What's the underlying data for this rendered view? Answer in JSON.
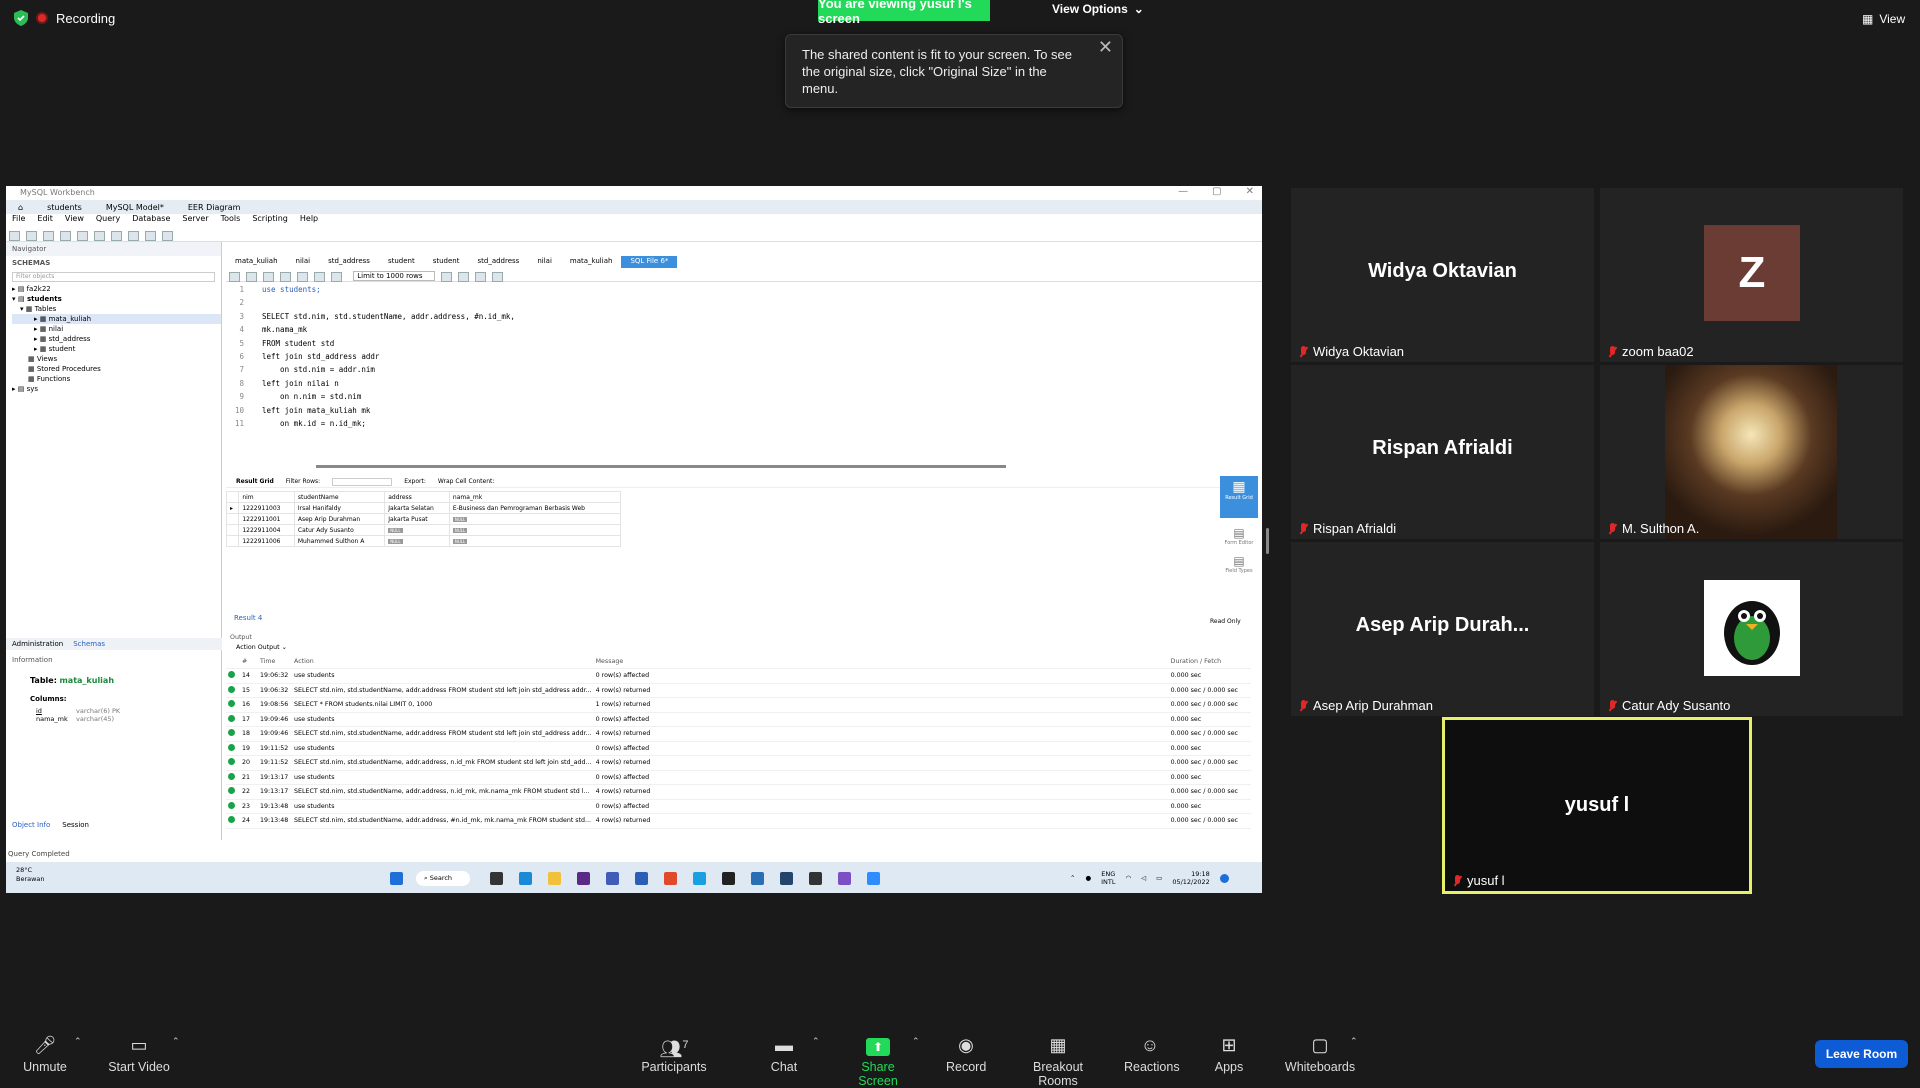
{
  "topbar": {
    "recording": "Recording",
    "viewing": "You are viewing yusuf l's screen",
    "view_options": "View Options",
    "view": "View"
  },
  "tooltip": {
    "text": "The shared content is fit to your screen. To see the original size, click \"Original Size\" in the menu."
  },
  "workbench": {
    "title": "MySQL Workbench",
    "tabs": [
      "students",
      "MySQL Model*",
      "EER Diagram"
    ],
    "menu": [
      "File",
      "Edit",
      "View",
      "Query",
      "Database",
      "Server",
      "Tools",
      "Scripting",
      "Help"
    ],
    "navigator": "Navigator",
    "schemas": "SCHEMAS",
    "filter": "Filter objects",
    "tree": [
      "fa2k22",
      "students",
      "Tables",
      "mata_kuliah",
      "nilai",
      "std_address",
      "student",
      "Views",
      "Stored Procedures",
      "Functions",
      "sys"
    ],
    "sql_tabs": [
      "mata_kuliah",
      "nilai",
      "std_address",
      "student",
      "student",
      "std_address",
      "nilai",
      "mata_kuliah",
      "SQL File 6*"
    ],
    "limit": "Limit to 1000 rows",
    "code": [
      "use students;",
      "",
      "SELECT std.nim, std.studentName, addr.address, #n.id_mk,",
      "mk.nama_mk",
      "FROM student std",
      "left join std_address addr",
      "    on std.nim = addr.nim",
      "left join nilai n",
      "    on n.nim = std.nim",
      "left join mata_kuliah mk",
      "    on mk.id = n.id_mk;"
    ],
    "result_bar": {
      "grid": "Result Grid",
      "filter": "Filter Rows:",
      "export": "Export:",
      "wrap": "Wrap Cell Content:"
    },
    "result_headers": [
      "nim",
      "studentName",
      "address",
      "nama_mk"
    ],
    "result_rows": [
      [
        "1222911003",
        "Irsal Hanifaldy",
        "Jakarta Selatan",
        "E-Business dan Pemrograman Berbasis Web"
      ],
      [
        "1222911001",
        "Asep Arip Durahman",
        "Jakarta Pusat",
        "NULL"
      ],
      [
        "1222911004",
        "Catur Ady Susanto",
        "NULL",
        "NULL"
      ],
      [
        "1222911006",
        "Muhammed Sulthon A",
        "NULL",
        "NULL"
      ]
    ],
    "side_buttons": [
      "Result Grid",
      "Form Editor",
      "Field Types"
    ],
    "read_only": "Read Only",
    "result_tab": "Result 4",
    "output_label": "Output",
    "action_output": "Action Output",
    "output_headers": [
      "#",
      "Time",
      "Action",
      "Message",
      "Duration / Fetch"
    ],
    "output_rows": [
      [
        "14",
        "19:06:32",
        "use students",
        "0 row(s) affected",
        "0.000 sec"
      ],
      [
        "15",
        "19:06:32",
        "SELECT std.nim, std.studentName, addr.address  FROM student std left join std_address addr...",
        "4 row(s) returned",
        "0.000 sec / 0.000 sec"
      ],
      [
        "16",
        "19:08:56",
        "SELECT * FROM students.nilai LIMIT 0, 1000",
        "1 row(s) returned",
        "0.000 sec / 0.000 sec"
      ],
      [
        "17",
        "19:09:46",
        "use students",
        "0 row(s) affected",
        "0.000 sec"
      ],
      [
        "18",
        "19:09:46",
        "SELECT std.nim, std.studentName, addr.address  FROM student std left join std_address addr...",
        "4 row(s) returned",
        "0.000 sec / 0.000 sec"
      ],
      [
        "19",
        "19:11:52",
        "use students",
        "0 row(s) affected",
        "0.000 sec"
      ],
      [
        "20",
        "19:11:52",
        "SELECT std.nim, std.studentName, addr.address, n.id_mk  FROM student std left join std_add...",
        "4 row(s) returned",
        "0.000 sec / 0.000 sec"
      ],
      [
        "21",
        "19:13:17",
        "use students",
        "0 row(s) affected",
        "0.000 sec"
      ],
      [
        "22",
        "19:13:17",
        "SELECT std.nim, std.studentName, addr.address, n.id_mk, mk.nama_mk  FROM student std l...",
        "4 row(s) returned",
        "0.000 sec / 0.000 sec"
      ],
      [
        "23",
        "19:13:48",
        "use students",
        "0 row(s) affected",
        "0.000 sec"
      ],
      [
        "24",
        "19:13:48",
        "SELECT std.nim, std.studentName, addr.address, #n.id_mk,  mk.nama_mk  FROM student std...",
        "4 row(s) returned",
        "0.000 sec / 0.000 sec"
      ]
    ],
    "info_tabs": [
      "Administration",
      "Schemas"
    ],
    "information": "Information",
    "table_label": "Table:",
    "table_name": "mata_kuliah",
    "columns_label": "Columns:",
    "columns": [
      [
        "id",
        "varchar(6) PK"
      ],
      [
        "nama_mk",
        "varchar(45)"
      ]
    ],
    "bottom_tabs": [
      "Object Info",
      "Session"
    ],
    "status": "Query Completed",
    "taskbar": {
      "temp": "28°C",
      "weather": "Berawan",
      "search": "Search",
      "lang1": "ENG",
      "lang2": "INTL",
      "time": "19:18",
      "date": "05/12/2022"
    }
  },
  "participants": [
    {
      "tile": "Widya Oktavian",
      "label": "Widya Oktavian"
    },
    {
      "tile": "Z",
      "label": "zoom baa02",
      "avatar_color": "#6b3c33"
    },
    {
      "tile": "Rispan Afrialdi",
      "label": "Rispan Afrialdi"
    },
    {
      "tile": "",
      "label": "M. Sulthon A."
    },
    {
      "tile": "Asep Arip Durah...",
      "label": "Asep Arip Durahman"
    },
    {
      "tile": "",
      "label": "Catur Ady Susanto"
    },
    {
      "tile": "yusuf l",
      "label": "yusuf l"
    }
  ],
  "bottombar": {
    "unmute": "Unmute",
    "start_video": "Start Video",
    "participants": "Participants",
    "participants_count": "7",
    "chat": "Chat",
    "share_screen": "Share Screen",
    "record": "Record",
    "breakout": "Breakout Rooms",
    "reactions": "Reactions",
    "apps": "Apps",
    "whiteboards": "Whiteboards",
    "leave": "Leave Room"
  },
  "colors": {
    "green": "#23d959",
    "leave": "#0e5bd6",
    "active_speaker": "#e8f06a"
  }
}
